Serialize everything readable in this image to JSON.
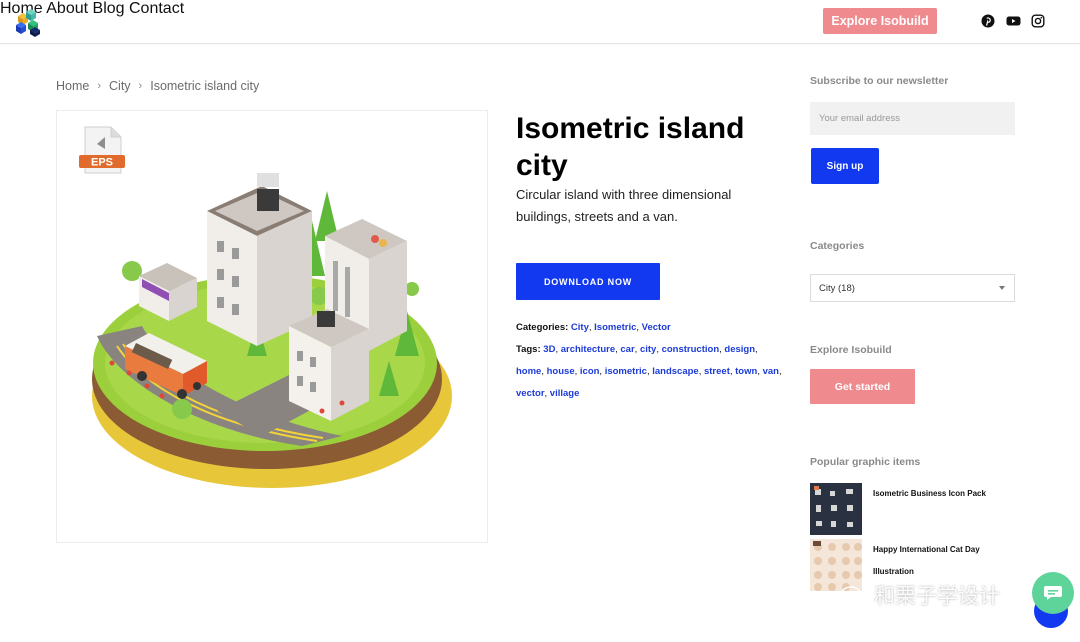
{
  "header": {
    "nav": [
      "Home",
      "About",
      "Blog",
      "Contact"
    ],
    "cta_label": "Explore Isobuild",
    "social": [
      "pinterest-icon",
      "youtube-icon",
      "instagram-icon"
    ]
  },
  "breadcrumb": [
    "Home",
    "City",
    "Isometric island city"
  ],
  "product": {
    "badge": "EPS",
    "title": "Isometric island city",
    "description": "Circular island with three dimensional buildings, streets and a van.",
    "download_label": "DOWNLOAD NOW",
    "categories_label": "Categories:",
    "categories": [
      "City",
      "Isometric",
      "Vector"
    ],
    "tags_label": "Tags:",
    "tags": [
      "3D",
      "architecture",
      "car",
      "city",
      "construction",
      "design",
      "home",
      "house",
      "icon",
      "isometric",
      "landscape",
      "street",
      "town",
      "van",
      "vector",
      "village"
    ]
  },
  "sidebar": {
    "newsletter_heading": "Subscribe to our newsletter",
    "email_placeholder": "Your email address",
    "signup_label": "Sign up",
    "categories_heading": "Categories",
    "category_selected": "City  (18)",
    "explore_heading": "Explore Isobuild",
    "get_started_label": "Get started",
    "popular_heading": "Popular graphic items",
    "popular_items": [
      {
        "title": "Isometric Business Icon Pack"
      },
      {
        "title": "Happy International Cat Day Illustration"
      }
    ]
  },
  "watermark": "和栗子学设计",
  "colors": {
    "accent_blue": "#1238f0",
    "accent_pink": "#ef8a8f",
    "link_blue": "#1c3bd8"
  }
}
